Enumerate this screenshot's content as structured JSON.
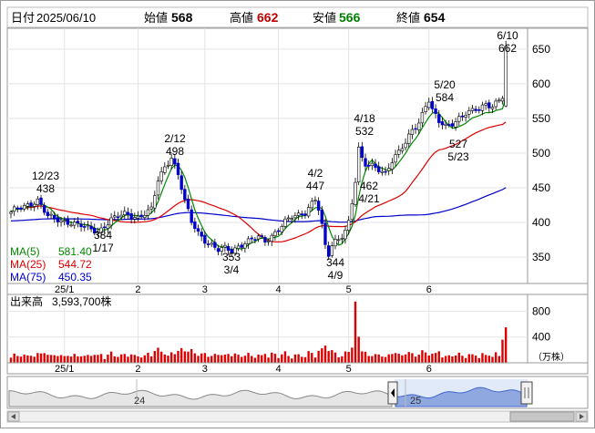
{
  "header": {
    "date_label": "日付",
    "date_value": "2025/06/10",
    "open_label": "始値",
    "open_value": "568",
    "high_label": "高値",
    "high_value": "662",
    "low_label": "安値",
    "low_value": "566",
    "close_label": "終値",
    "close_value": "654"
  },
  "colors": {
    "up": "#00aa00",
    "down": "#0000cc",
    "ma5": "#008800",
    "ma25": "#dd0000",
    "ma75": "#0000cc",
    "volume": "#dd0000",
    "volume_highlight": "#bb0000",
    "accent_green": "#008000",
    "accent_red": "#c00000"
  },
  "legend": {
    "ma5_label": "MA(5)",
    "ma5_value": "581.40",
    "ma25_label": "MA(25)",
    "ma25_value": "544.72",
    "ma75_label": "MA(75)",
    "ma75_value": "450.35"
  },
  "volume": {
    "label": "出来高",
    "value": "3,593,700株",
    "unit": "（万株）"
  },
  "chart_data": {
    "type": "candlestick",
    "price_axis": {
      "ticks": [
        "350",
        "400",
        "450",
        "500",
        "550",
        "600",
        "650"
      ],
      "ylim": [
        312,
        680
      ]
    },
    "volume_axis": {
      "ticks": [
        "400",
        "800"
      ],
      "ylim": [
        0,
        1060
      ]
    },
    "x_ticks": [
      "25/1",
      "2",
      "3",
      "4",
      "5",
      "6"
    ],
    "navigator_labels": [
      "24",
      "25"
    ],
    "annotations": [
      {
        "label": "12/23",
        "value": "438"
      },
      {
        "label": "1/17",
        "value": "384"
      },
      {
        "label": "2/12",
        "value": "498"
      },
      {
        "label": "3/4",
        "value": "353"
      },
      {
        "label": "4/2",
        "value": "447"
      },
      {
        "label": "4/9",
        "value": "344"
      },
      {
        "label": "4/18",
        "value": "532"
      },
      {
        "label": "4/21",
        "value": "462"
      },
      {
        "label": "5/20",
        "value": "584"
      },
      {
        "label": "5/23",
        "value": "527"
      },
      {
        "label": "6/10",
        "value": "662"
      }
    ],
    "anchors": [
      [
        0,
        415
      ],
      [
        5,
        426
      ],
      [
        8,
        432
      ],
      [
        11,
        408
      ],
      [
        14,
        404
      ],
      [
        18,
        400
      ],
      [
        22,
        393
      ],
      [
        26,
        387
      ],
      [
        30,
        404
      ],
      [
        34,
        412
      ],
      [
        38,
        408
      ],
      [
        42,
        418
      ],
      [
        44,
        460
      ],
      [
        46,
        480
      ],
      [
        48,
        495
      ],
      [
        50,
        470
      ],
      [
        52,
        430
      ],
      [
        54,
        400
      ],
      [
        56,
        385
      ],
      [
        58,
        375
      ],
      [
        60,
        368
      ],
      [
        62,
        360
      ],
      [
        64,
        362
      ],
      [
        66,
        358
      ],
      [
        68,
        366
      ],
      [
        70,
        372
      ],
      [
        72,
        376
      ],
      [
        74,
        378
      ],
      [
        76,
        372
      ],
      [
        78,
        381
      ],
      [
        80,
        392
      ],
      [
        82,
        402
      ],
      [
        84,
        407
      ],
      [
        86,
        409
      ],
      [
        88,
        414
      ],
      [
        90,
        430
      ],
      [
        91,
        436
      ],
      [
        92,
        420
      ],
      [
        93,
        395
      ],
      [
        94,
        365
      ],
      [
        95,
        352
      ],
      [
        96,
        365
      ],
      [
        97,
        372
      ],
      [
        98,
        376
      ],
      [
        99,
        382
      ],
      [
        100,
        390
      ],
      [
        101,
        402
      ],
      [
        102,
        430
      ],
      [
        103,
        460
      ],
      [
        104,
        505
      ],
      [
        105,
        490
      ],
      [
        106,
        482
      ],
      [
        108,
        482
      ],
      [
        110,
        478
      ],
      [
        112,
        472
      ],
      [
        114,
        488
      ],
      [
        116,
        500
      ],
      [
        118,
        515
      ],
      [
        120,
        535
      ],
      [
        122,
        545
      ],
      [
        124,
        568
      ],
      [
        125,
        575
      ],
      [
        126,
        560
      ],
      [
        128,
        545
      ],
      [
        130,
        540
      ],
      [
        132,
        544
      ],
      [
        134,
        550
      ],
      [
        136,
        556
      ],
      [
        138,
        560
      ],
      [
        140,
        565
      ],
      [
        142,
        572
      ],
      [
        144,
        568
      ],
      [
        146,
        575
      ],
      [
        147,
        580
      ],
      [
        148,
        654
      ]
    ],
    "last_candle": {
      "open": 568,
      "high": 662,
      "low": 566,
      "close": 654
    },
    "ma_values": {
      "ma5": 581.4,
      "ma25": 544.72,
      "ma75": 450.35
    },
    "volume_spikes": [
      {
        "index": 103,
        "value": 950
      },
      {
        "index": 147,
        "value": 359
      }
    ]
  }
}
